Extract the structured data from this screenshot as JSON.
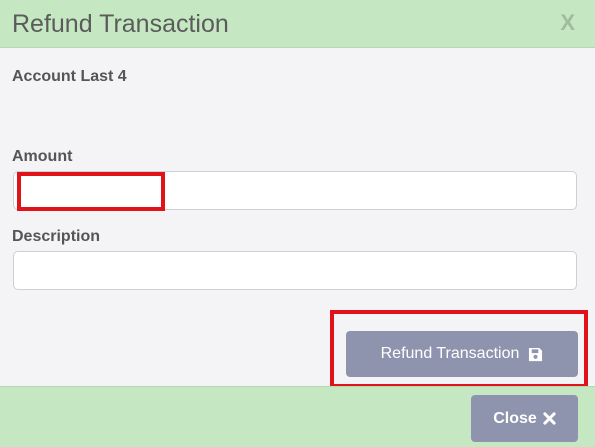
{
  "dialog": {
    "title": "Refund Transaction",
    "close_x": "X"
  },
  "form": {
    "account_label": "Account Last 4",
    "account_value": "-",
    "amount_label": "Amount",
    "amount_value": "",
    "description_label": "Description",
    "description_value": ""
  },
  "actions": {
    "refund_label": "Refund Transaction",
    "refund_icon": "save-icon",
    "close_label": "Close",
    "close_icon": "times-icon"
  },
  "colors": {
    "header_bg": "#c5e8c2",
    "button_bg": "#8e94ad",
    "highlight": "#e0131b"
  }
}
